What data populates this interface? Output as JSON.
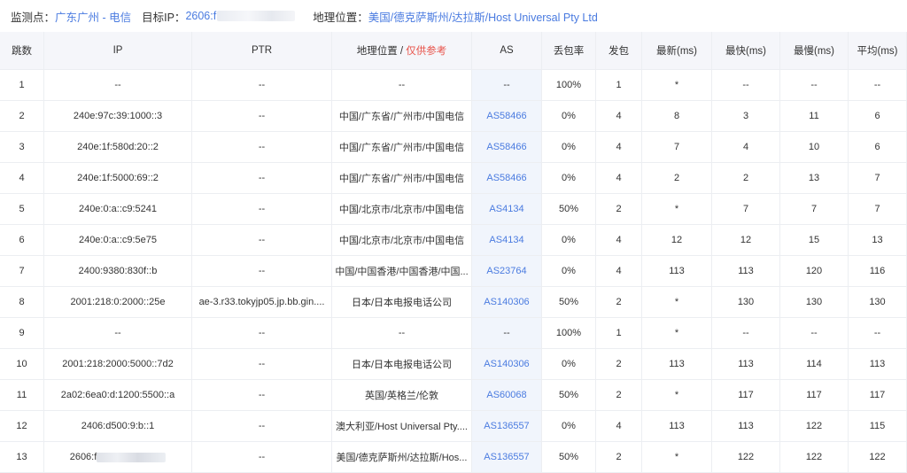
{
  "header": {
    "monitor_label": "监测点：",
    "monitor_value": "广东广州 - 电信",
    "target_label": "目标IP：",
    "target_value": "2606:f",
    "geo_label": "地理位置：",
    "geo_value": "美国/德克萨斯州/达拉斯/Host Universal Pty Ltd"
  },
  "columns": {
    "hop": "跳数",
    "ip": "IP",
    "ptr": "PTR",
    "geo_main": "地理位置",
    "geo_sep": " / ",
    "geo_hint": "仅供参考",
    "as": "AS",
    "loss": "丢包率",
    "sent": "发包",
    "last": "最新(ms)",
    "best": "最快(ms)",
    "worst": "最慢(ms)",
    "avg": "平均(ms)"
  },
  "rows": [
    {
      "hop": "1",
      "ip": "--",
      "ptr": "--",
      "geo": "--",
      "as": "--",
      "loss": "100%",
      "sent": "1",
      "last": "*",
      "best": "--",
      "worst": "--",
      "avg": "--"
    },
    {
      "hop": "2",
      "ip": "240e:97c:39:1000::3",
      "ptr": "--",
      "geo": "中国/广东省/广州市/中国电信",
      "as": "AS58466",
      "loss": "0%",
      "sent": "4",
      "last": "8",
      "best": "3",
      "worst": "11",
      "avg": "6"
    },
    {
      "hop": "3",
      "ip": "240e:1f:580d:20::2",
      "ptr": "--",
      "geo": "中国/广东省/广州市/中国电信",
      "as": "AS58466",
      "loss": "0%",
      "sent": "4",
      "last": "7",
      "best": "4",
      "worst": "10",
      "avg": "6"
    },
    {
      "hop": "4",
      "ip": "240e:1f:5000:69::2",
      "ptr": "--",
      "geo": "中国/广东省/广州市/中国电信",
      "as": "AS58466",
      "loss": "0%",
      "sent": "4",
      "last": "2",
      "best": "2",
      "worst": "13",
      "avg": "7"
    },
    {
      "hop": "5",
      "ip": "240e:0:a::c9:5241",
      "ptr": "--",
      "geo": "中国/北京市/北京市/中国电信",
      "as": "AS4134",
      "loss": "50%",
      "sent": "2",
      "last": "*",
      "best": "7",
      "worst": "7",
      "avg": "7"
    },
    {
      "hop": "6",
      "ip": "240e:0:a::c9:5e75",
      "ptr": "--",
      "geo": "中国/北京市/北京市/中国电信",
      "as": "AS4134",
      "loss": "0%",
      "sent": "4",
      "last": "12",
      "best": "12",
      "worst": "15",
      "avg": "13"
    },
    {
      "hop": "7",
      "ip": "2400:9380:830f::b",
      "ptr": "--",
      "geo": "中国/中国香港/中国香港/中国...",
      "as": "AS23764",
      "loss": "0%",
      "sent": "4",
      "last": "113",
      "best": "113",
      "worst": "120",
      "avg": "116"
    },
    {
      "hop": "8",
      "ip": "2001:218:0:2000::25e",
      "ptr": "ae-3.r33.tokyjp05.jp.bb.gin....",
      "geo": "日本/日本电报电话公司",
      "as": "AS140306",
      "loss": "50%",
      "sent": "2",
      "last": "*",
      "best": "130",
      "worst": "130",
      "avg": "130"
    },
    {
      "hop": "9",
      "ip": "--",
      "ptr": "--",
      "geo": "--",
      "as": "--",
      "loss": "100%",
      "sent": "1",
      "last": "*",
      "best": "--",
      "worst": "--",
      "avg": "--"
    },
    {
      "hop": "10",
      "ip": "2001:218:2000:5000::7d2",
      "ptr": "--",
      "geo": "日本/日本电报电话公司",
      "as": "AS140306",
      "loss": "0%",
      "sent": "2",
      "last": "113",
      "best": "113",
      "worst": "114",
      "avg": "113"
    },
    {
      "hop": "11",
      "ip": "2a02:6ea0:d:1200:5500::a",
      "ptr": "--",
      "geo": "英国/英格兰/伦敦",
      "as": "AS60068",
      "loss": "50%",
      "sent": "2",
      "last": "*",
      "best": "117",
      "worst": "117",
      "avg": "117"
    },
    {
      "hop": "12",
      "ip": "2406:d500:9:b::1",
      "ptr": "--",
      "geo": "澳大利亚/Host Universal Pty....",
      "as": "AS136557",
      "loss": "0%",
      "sent": "4",
      "last": "113",
      "best": "113",
      "worst": "122",
      "avg": "115"
    },
    {
      "hop": "13",
      "ip": "2606:f",
      "ip_redacted": true,
      "ptr": "--",
      "geo": "美国/德克萨斯州/达拉斯/Hos...",
      "as": "AS136557",
      "loss": "50%",
      "sent": "2",
      "last": "*",
      "best": "122",
      "worst": "122",
      "avg": "122"
    }
  ],
  "colors": {
    "link": "#4a7be0",
    "hint": "#e8534a",
    "header_bg": "#f5f6fa",
    "as_cell_bg": "#f1f5fc"
  }
}
